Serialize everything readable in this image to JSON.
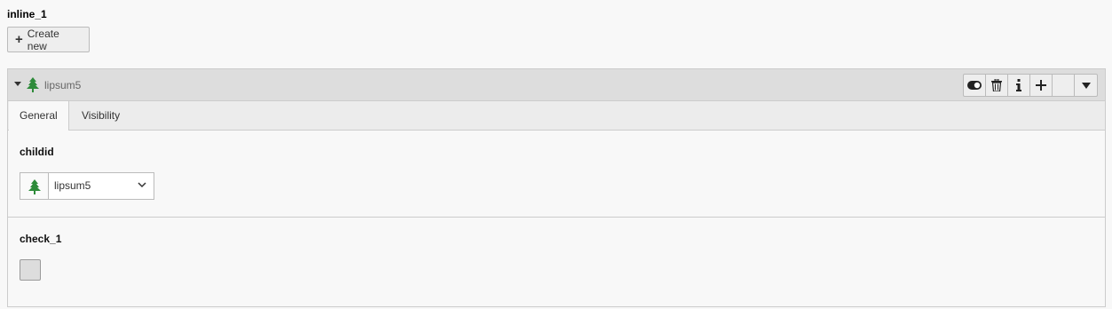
{
  "field_title": "inline_1",
  "create_button_label": "Create new",
  "record": {
    "title": "lipsum5",
    "tabs": [
      {
        "label": "General",
        "active": true
      },
      {
        "label": "Visibility",
        "active": false
      }
    ],
    "fields": {
      "childid": {
        "label": "childid",
        "selected": "lipsum5"
      },
      "check_1": {
        "label": "check_1",
        "checked": false
      }
    }
  },
  "header_buttons": [
    "toggle-icon",
    "trash-icon",
    "info-icon",
    "plus-icon",
    "empty",
    "caret-down-icon"
  ],
  "colors": {
    "tree": "#2e8b3a",
    "header_bg": "#dddddd",
    "tabs_bg": "#ececec"
  }
}
